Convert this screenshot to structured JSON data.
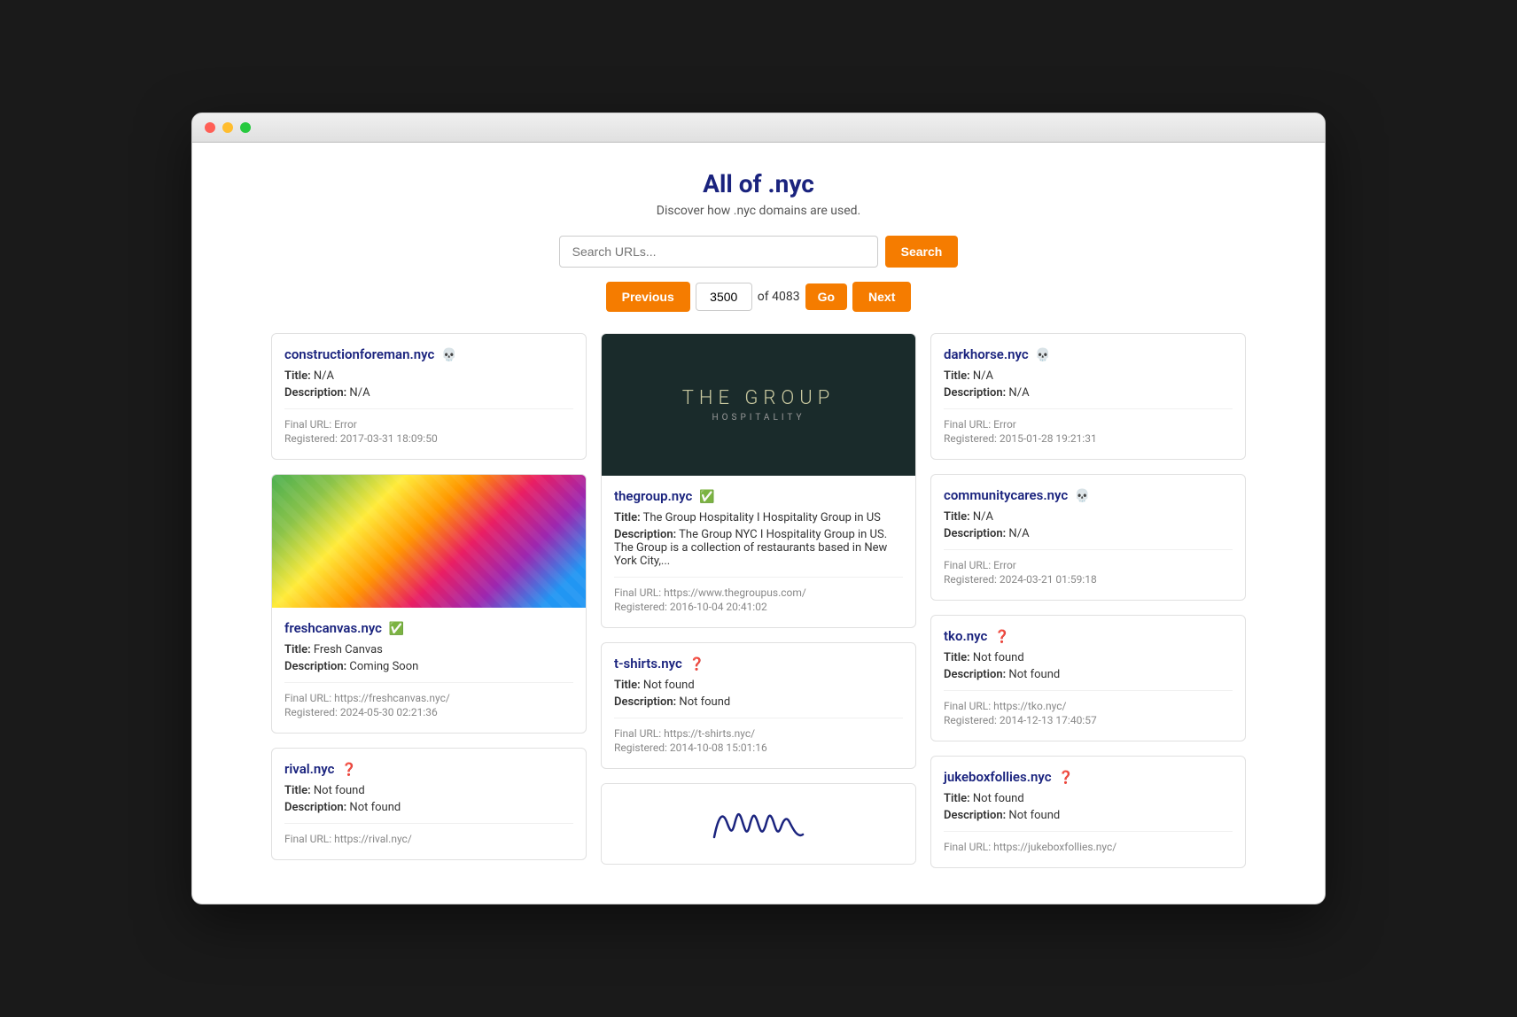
{
  "page": {
    "title": "All of .nyc",
    "subtitle": "Discover how .nyc domains are used."
  },
  "search": {
    "placeholder": "Search URLs...",
    "button_label": "Search"
  },
  "pagination": {
    "previous_label": "Previous",
    "next_label": "Next",
    "go_label": "Go",
    "current_page": "3500",
    "total_pages": "4083",
    "of_text": "of"
  },
  "cards": [
    {
      "id": "constructionforeman",
      "domain": "constructionforeman.nyc",
      "status_icon": "💀",
      "title_value": "N/A",
      "description_value": "N/A",
      "final_url": "Error",
      "registered": "2017-03-31 18:09:50",
      "has_image": false,
      "image_type": null
    },
    {
      "id": "thegroup",
      "domain": "thegroup.nyc",
      "status_icon": "✅",
      "title_value": "The Group Hospitality I Hospitality Group in US",
      "description_value": "The Group NYC I Hospitality Group in US. The Group is a collection of restaurants based in New York City,...",
      "final_url": "https://www.thegroupus.com/",
      "registered": "2016-10-04 20:41:02",
      "has_image": true,
      "image_type": "dark_header"
    },
    {
      "id": "darkhorse",
      "domain": "darkhorse.nyc",
      "status_icon": "💀",
      "title_value": "N/A",
      "description_value": "N/A",
      "final_url": "Error",
      "registered": "2015-01-28 19:21:31",
      "has_image": false,
      "image_type": null
    },
    {
      "id": "freshcanvas",
      "domain": "freshcanvas.nyc",
      "status_icon": "✅",
      "title_value": "Fresh Canvas",
      "description_value": "Coming Soon",
      "final_url": "https://freshcanvas.nyc/",
      "registered": "2024-05-30 02:21:36",
      "has_image": true,
      "image_type": "painting"
    },
    {
      "id": "tshirts",
      "domain": "t-shirts.nyc",
      "status_icon": "❓",
      "title_value": "Not found",
      "description_value": "Not found",
      "final_url": "https://t-shirts.nyc/",
      "registered": "2014-10-08 15:01:16",
      "has_image": false,
      "image_type": null
    },
    {
      "id": "communitycares",
      "domain": "communitycares.nyc",
      "status_icon": "💀",
      "title_value": "N/A",
      "description_value": "N/A",
      "final_url": "Error",
      "registered": "2024-03-21 01:59:18",
      "has_image": false,
      "image_type": null
    },
    {
      "id": "rival",
      "domain": "rival.nyc",
      "status_icon": "❓",
      "title_value": "Not found",
      "description_value": "Not found",
      "final_url": "https://rival.nyc/",
      "registered": "",
      "has_image": false,
      "image_type": null
    },
    {
      "id": "hannah",
      "domain": "",
      "status_icon": "",
      "title_value": "",
      "description_value": "",
      "final_url": "",
      "registered": "",
      "has_image": true,
      "image_type": "signature"
    },
    {
      "id": "tko",
      "domain": "tko.nyc",
      "status_icon": "❓",
      "title_value": "Not found",
      "description_value": "Not found",
      "final_url": "https://tko.nyc/",
      "registered": "2014-12-13 17:40:57",
      "has_image": false,
      "image_type": null
    },
    {
      "id": "jukeboxfollies",
      "domain": "jukeboxfollies.nyc",
      "status_icon": "❓",
      "title_value": "Not found",
      "description_value": "Not found",
      "final_url": "https://jukeboxfollies.nyc/",
      "registered": "",
      "has_image": false,
      "image_type": null
    }
  ],
  "labels": {
    "title_label": "Title:",
    "description_label": "Description:",
    "final_url_label": "Final URL:",
    "registered_label": "Registered:"
  }
}
